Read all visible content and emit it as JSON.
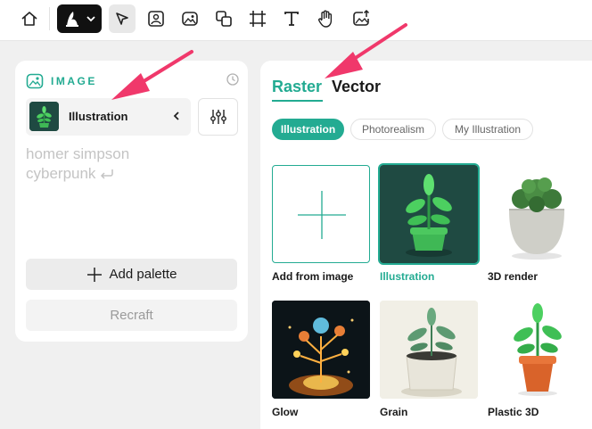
{
  "colors": {
    "accent": "#23ab92",
    "arrow": "#f0386b",
    "panel_bg": "#ffffff",
    "page_bg": "#f0f0f0"
  },
  "toolbar": {
    "tools": [
      {
        "name": "home-icon"
      },
      {
        "name": "recraft-logo-icon"
      },
      {
        "name": "select-cursor-icon"
      },
      {
        "name": "image-frame-icon"
      },
      {
        "name": "image-edit-icon"
      },
      {
        "name": "layers-icon"
      },
      {
        "name": "crop-frame-icon"
      },
      {
        "name": "text-tool-icon"
      },
      {
        "name": "hand-tool-icon"
      },
      {
        "name": "upload-image-icon"
      }
    ]
  },
  "left_panel": {
    "section_label": "IMAGE",
    "style_select": {
      "value": "Illustration"
    },
    "prompt": {
      "line1": "homer simpson",
      "line2": "cyberpunk"
    },
    "add_palette_label": "Add palette",
    "recraft_label": "Recraft"
  },
  "right_panel": {
    "tabs": [
      {
        "label": "Raster",
        "active": true
      },
      {
        "label": "Vector",
        "active": false
      }
    ],
    "chips": [
      {
        "label": "Illustration",
        "active": true
      },
      {
        "label": "Photorealism",
        "active": false
      },
      {
        "label": "My Illustration",
        "active": false
      }
    ],
    "styles": [
      {
        "label": "Add from image"
      },
      {
        "label": "Illustration",
        "selected": true
      },
      {
        "label": "3D render"
      },
      {
        "label": "Glow"
      },
      {
        "label": "Grain"
      },
      {
        "label": "Plastic 3D"
      }
    ]
  }
}
